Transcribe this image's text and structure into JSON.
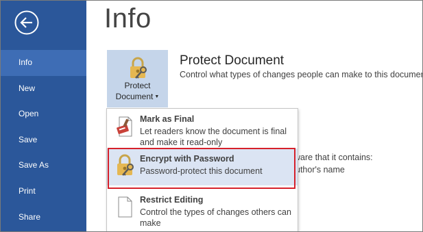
{
  "sidebar": {
    "items": [
      {
        "label": "Info",
        "active": true
      },
      {
        "label": "New",
        "active": false
      },
      {
        "label": "Open",
        "active": false
      },
      {
        "label": "Save",
        "active": false
      },
      {
        "label": "Save As",
        "active": false
      },
      {
        "label": "Print",
        "active": false
      },
      {
        "label": "Share",
        "active": false
      }
    ]
  },
  "page": {
    "title": "Info"
  },
  "protect": {
    "button_line1": "Protect",
    "button_line2": "Document",
    "section_title": "Protect Document",
    "section_desc": "Control what types of changes people can make to this documen"
  },
  "background": {
    "inspect_line": "ware that it contains:",
    "author_line": "uthor's name"
  },
  "menu": {
    "items": [
      {
        "title": "Mark as Final",
        "desc": "Let readers know the document is final and make it read-only",
        "icon": "mark-final-icon"
      },
      {
        "title": "Encrypt with Password",
        "desc": "Password-protect this document",
        "icon": "lock-key-icon",
        "highlighted": true
      },
      {
        "title": "Restrict Editing",
        "desc": "Control the types of changes others can make",
        "icon": "document-icon"
      }
    ]
  },
  "colors": {
    "sidebar": "#2b579a",
    "sidebar_active": "#3e6db5",
    "button_bg": "#c5d5ea",
    "highlight": "#dbe4f3",
    "annotation_box": "#d6202a"
  }
}
